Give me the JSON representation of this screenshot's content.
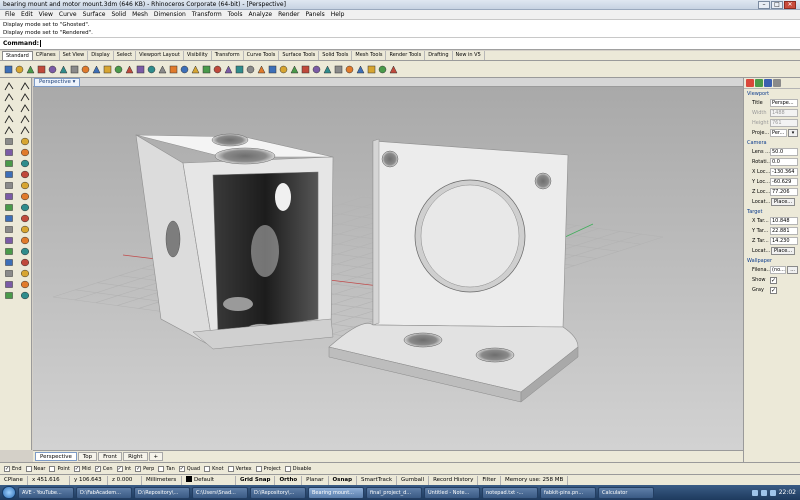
{
  "window": {
    "title": "bearing mount and motor mount.3dm (646 KB) - Rhinoceros Corporate (64-bit) - [Perspective]",
    "min": "–",
    "max": "□",
    "close": "✕"
  },
  "menu": [
    "File",
    "Edit",
    "View",
    "Curve",
    "Surface",
    "Solid",
    "Mesh",
    "Dimension",
    "Transform",
    "Tools",
    "Analyze",
    "Render",
    "Panels",
    "Help"
  ],
  "history": [
    "Display mode set to \"Ghosted\".",
    "Display mode set to \"Rendered\"."
  ],
  "command": {
    "label": "Command:"
  },
  "toolbar_tabs": [
    "Standard",
    "CPlanes",
    "Set View",
    "Display",
    "Select",
    "Viewport Layout",
    "Visibility",
    "Transform",
    "Curve Tools",
    "Surface Tools",
    "Solid Tools",
    "Mesh Tools",
    "Render Tools",
    "Drafting",
    "New in V5"
  ],
  "active_toolbar_tab": "Standard",
  "toolbar_icons": [
    "new-icon",
    "open-icon",
    "save-icon",
    "print-icon",
    "import-icon",
    "cut-icon",
    "copy-icon",
    "paste-icon",
    "undo-icon",
    "redo-icon",
    "pan-icon",
    "rotate-view-icon",
    "zoom-dynamic-icon",
    "zoom-window-icon",
    "zoom-extents-icon",
    "zoom-selected-icon",
    "four-viewports-icon",
    "cplane-icon",
    "grid-icon",
    "select-all-icon",
    "hide-icon",
    "show-icon",
    "lock-icon",
    "layer-icon",
    "properties-icon",
    "render-icon",
    "material-icon",
    "sun-icon",
    "light-icon",
    "environment-icon",
    "texture-icon",
    "shaded-icon",
    "rendered-icon",
    "ghosted-icon",
    "options-icon",
    "help-icon"
  ],
  "left_tools": [
    "select-arrow-icon",
    "point-icon",
    "polyline-icon",
    "line-icon",
    "curve-icon",
    "circle-icon",
    "arc-icon",
    "rectangle-icon",
    "polygon-icon",
    "ellipse-icon",
    "box-icon",
    "sphere-icon",
    "cylinder-icon",
    "surface-icon",
    "extrude-icon",
    "loft-icon",
    "fillet-icon",
    "chamfer-icon",
    "join-icon",
    "explode-icon",
    "trim-icon",
    "split-icon",
    "boolean-union-icon",
    "boolean-difference-icon",
    "move-icon",
    "copy-tool-icon",
    "rotate-icon",
    "scale-icon",
    "mirror-icon",
    "array-icon",
    "grid-snap-icon",
    "ortho-icon",
    "analyze-icon",
    "check-icon",
    "text-icon",
    "dimension-icon",
    "mesh-icon",
    "render-tool-icon",
    "layers-icon",
    "settings-tool-icon"
  ],
  "viewport": {
    "name": "Perspective",
    "dropdown": "▾"
  },
  "view_tabs": [
    "Perspective",
    "Top",
    "Front",
    "Right"
  ],
  "active_view_tab": "Perspective",
  "view_tab_add": "+",
  "panel": {
    "viewport_header": "Viewport",
    "title_label": "Title",
    "title_value": "Perspe...",
    "width_label": "Width",
    "width_value": "1488",
    "height_label": "Height",
    "height_value": "761",
    "projection_label": "Proje...",
    "projection_value": "Per...",
    "camera_header": "Camera",
    "lens_label": "Lens ...",
    "lens_value": "50.0",
    "rotation_label": "Rotati...",
    "rotation_value": "0.0",
    "xloc_label": "X Loc...",
    "xloc_value": "-130.364",
    "yloc_label": "Y Loc...",
    "yloc_value": "-60.629",
    "zloc_label": "Z Loc...",
    "zloc_value": "77.206",
    "cam_location_label": "Locat...",
    "place_button": "Place...",
    "target_header": "Target",
    "xtar_label": "X Tar...",
    "xtar_value": "10.848",
    "ytar_label": "Y Tar...",
    "ytar_value": "22.881",
    "ztar_label": "Z Tar...",
    "ztar_value": "14.230",
    "tar_location_label": "Locat...",
    "tar_place_button": "Place...",
    "wallpaper_header": "Wallpaper",
    "filename_label": "Filena...",
    "filename_value": "(no...",
    "browse_button": "...",
    "show_label": "Show",
    "gray_label": "Gray",
    "checked_mark": "✓"
  },
  "osnap": [
    {
      "label": "End",
      "checked": true
    },
    {
      "label": "Near",
      "checked": false
    },
    {
      "label": "Point",
      "checked": false
    },
    {
      "label": "Mid",
      "checked": true
    },
    {
      "label": "Cen",
      "checked": true
    },
    {
      "label": "Int",
      "checked": true
    },
    {
      "label": "Perp",
      "checked": true
    },
    {
      "label": "Tan",
      "checked": false
    },
    {
      "label": "Quad",
      "checked": true
    },
    {
      "label": "Knot",
      "checked": false
    },
    {
      "label": "Vertex",
      "checked": false
    },
    {
      "label": "Project",
      "checked": false
    },
    {
      "label": "Disable",
      "checked": false
    }
  ],
  "status": {
    "cplane": "CPlane",
    "x": "x 451.616",
    "y": "y 106.643",
    "z": "z 0.000",
    "units": "Millimeters",
    "layer": "Default",
    "grid_snap": "Grid Snap",
    "ortho": "Ortho",
    "planar": "Planar",
    "osnap": "Osnap",
    "smarttrack": "SmartTrack",
    "gumball": "Gumball",
    "record_history": "Record History",
    "filter": "Filter",
    "memory": "Memory use: 258 MB"
  },
  "taskbar": {
    "tasks": [
      "AVE - YouTube...",
      "D:\\FabAcadem...",
      "D:\\Repository\\...",
      "C:\\Users\\Snad...",
      "D:\\Repository\\...",
      "Bearing mount...",
      "final_project_d...",
      "Untitled - Note...",
      "notepad.txt -...",
      "fabkit-pins.pn...",
      "Calculator"
    ],
    "active_task": "Bearing mount...",
    "clock": "22:02"
  },
  "colors": {
    "viewport_bg": "#c3c3c3",
    "model": "#ececec",
    "grid": "#b0b0b0",
    "x_axis": "#c04a4a",
    "y_axis": "#3fae5a"
  }
}
